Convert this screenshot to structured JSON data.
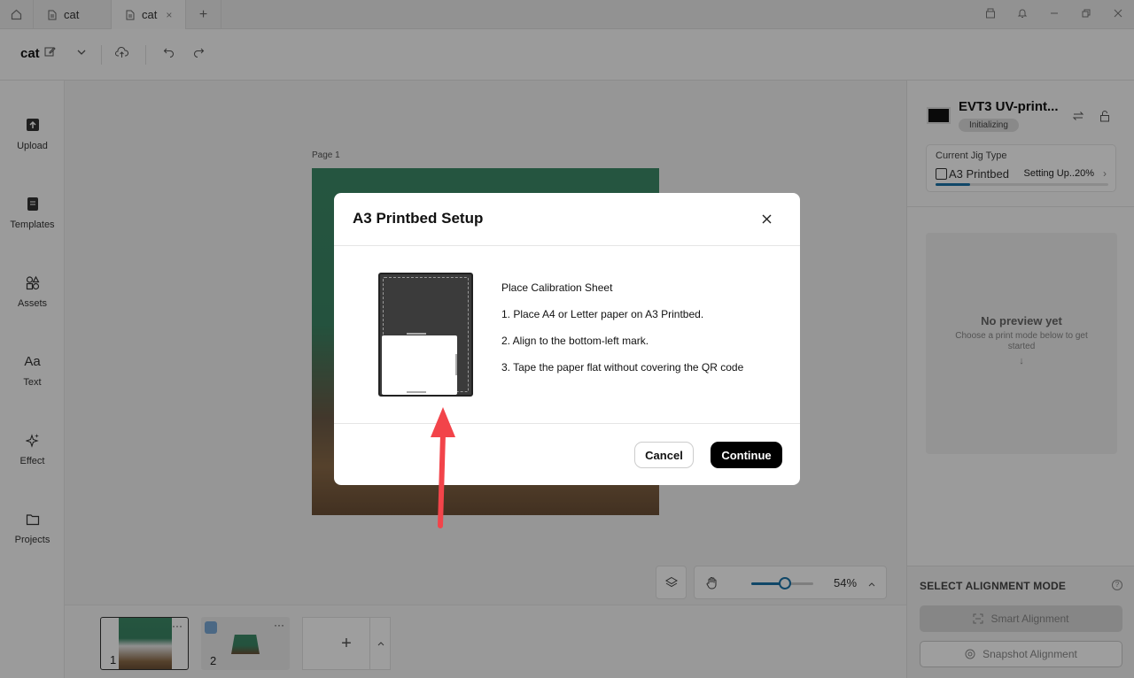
{
  "tabs": {
    "items": [
      {
        "label": "cat"
      },
      {
        "label": "cat",
        "close": "×"
      }
    ],
    "add": "+"
  },
  "window_controls": [
    "archive-icon",
    "bell-icon",
    "minimize-icon",
    "restore-icon",
    "close-icon"
  ],
  "toolbar": {
    "doc_title": "cat"
  },
  "sidebar": {
    "items": [
      {
        "label": "Upload",
        "icon": "upload-icon"
      },
      {
        "label": "Templates",
        "icon": "templates-icon"
      },
      {
        "label": "Assets",
        "icon": "assets-icon"
      },
      {
        "label": "Text",
        "icon": "text-icon",
        "glyph": "Aa"
      },
      {
        "label": "Effect",
        "icon": "sparkle-icon"
      },
      {
        "label": "Projects",
        "icon": "folder-icon"
      }
    ]
  },
  "canvas": {
    "page_label": "Page 1",
    "zoom": {
      "label": "54%",
      "level": 0.54
    }
  },
  "thumbnails": {
    "items": [
      {
        "num": "1",
        "more": "···",
        "active": true
      },
      {
        "num": "2",
        "more": "···",
        "active": false
      }
    ],
    "add": "+"
  },
  "right_panel": {
    "printer_name": "EVT3 UV-print...",
    "status": "Initializing",
    "jig": {
      "title": "Current Jig Type",
      "name": "A3 Printbed",
      "progress_text": "Setting Up..20%",
      "progress": 0.2
    },
    "preview": {
      "title": "No preview yet",
      "subtitle": "Choose a print mode below to get started"
    },
    "alignment": {
      "title": "SELECT ALIGNMENT MODE",
      "smart": "Smart Alignment",
      "snapshot": "Snapshot Alignment"
    }
  },
  "modal": {
    "title": "A3 Printbed Setup",
    "heading": "Place Calibration Sheet",
    "steps": [
      "1. Place A4 or Letter paper on A3 Printbed.",
      "2. Align to the bottom-left mark.",
      "3. Tape the paper flat without covering the QR code"
    ],
    "cancel": "Cancel",
    "continue": "Continue"
  },
  "colors": {
    "accent": "#1a73a8",
    "annotation_arrow": "#f2444a",
    "primary_button": "#000000"
  }
}
